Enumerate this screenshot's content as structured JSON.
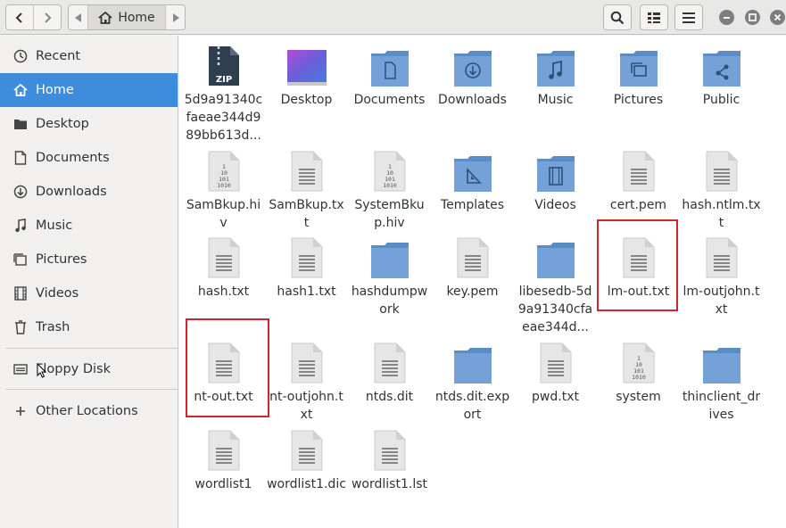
{
  "toolbar": {
    "breadcrumb_label": "Home",
    "icons": [
      "back-icon",
      "forward-icon",
      "path-left-icon",
      "home-icon",
      "path-right-icon",
      "search-icon",
      "view-toggle-icon",
      "menu-icon",
      "minimize-icon",
      "maximize-icon",
      "close-icon"
    ]
  },
  "sidebar": {
    "items": [
      {
        "label": "Recent",
        "icon": "clock-icon"
      },
      {
        "label": "Home",
        "icon": "home-icon",
        "active": true
      },
      {
        "label": "Desktop",
        "icon": "folder-icon"
      },
      {
        "label": "Documents",
        "icon": "document-icon"
      },
      {
        "label": "Downloads",
        "icon": "download-icon"
      },
      {
        "label": "Music",
        "icon": "music-icon"
      },
      {
        "label": "Pictures",
        "icon": "pictures-icon"
      },
      {
        "label": "Videos",
        "icon": "film-icon"
      },
      {
        "label": "Trash",
        "icon": "trash-icon"
      },
      {
        "label": "Floppy Disk",
        "icon": "drive-icon"
      },
      {
        "label": "Other Locations",
        "icon": "plus-icon"
      }
    ]
  },
  "files": [
    {
      "name": "5d9a91340cfaeae344d989bb613d...",
      "type": "zip"
    },
    {
      "name": "Desktop",
      "type": "desktop"
    },
    {
      "name": "Documents",
      "type": "folder-documents"
    },
    {
      "name": "Downloads",
      "type": "folder-downloads"
    },
    {
      "name": "Music",
      "type": "folder-music"
    },
    {
      "name": "Pictures",
      "type": "folder-pictures"
    },
    {
      "name": "Public",
      "type": "folder-public"
    },
    {
      "name": "SamBkup.hiv",
      "type": "binary"
    },
    {
      "name": "SamBkup.txt",
      "type": "text"
    },
    {
      "name": "SystemBkup.hiv",
      "type": "binary"
    },
    {
      "name": "Templates",
      "type": "folder-templates"
    },
    {
      "name": "Videos",
      "type": "folder-videos"
    },
    {
      "name": "cert.pem",
      "type": "text"
    },
    {
      "name": "hash.ntlm.txt",
      "type": "text"
    },
    {
      "name": "hash.txt",
      "type": "text"
    },
    {
      "name": "hash1.txt",
      "type": "text"
    },
    {
      "name": "hashdumpwork",
      "type": "folder"
    },
    {
      "name": "key.pem",
      "type": "text"
    },
    {
      "name": "libesedb-5d9a91340cfaeae344d...",
      "type": "folder"
    },
    {
      "name": "lm-out.txt",
      "type": "text",
      "highlighted": true
    },
    {
      "name": "lm-outjohn.txt",
      "type": "text"
    },
    {
      "name": "nt-out.txt",
      "type": "text",
      "highlighted": true
    },
    {
      "name": "nt-outjohn.txt",
      "type": "text"
    },
    {
      "name": "ntds.dit",
      "type": "text"
    },
    {
      "name": "ntds.dit.export",
      "type": "folder"
    },
    {
      "name": "pwd.txt",
      "type": "text"
    },
    {
      "name": "system",
      "type": "binary"
    },
    {
      "name": "thinclient_drives",
      "type": "folder"
    },
    {
      "name": "wordlist1",
      "type": "text"
    },
    {
      "name": "wordlist1.dic",
      "type": "text"
    },
    {
      "name": "wordlist1.lst",
      "type": "text"
    }
  ],
  "colors": {
    "sidebar_active": "#3e8ddd",
    "folder": "#6d9bd3",
    "highlight": "#d6232b"
  }
}
